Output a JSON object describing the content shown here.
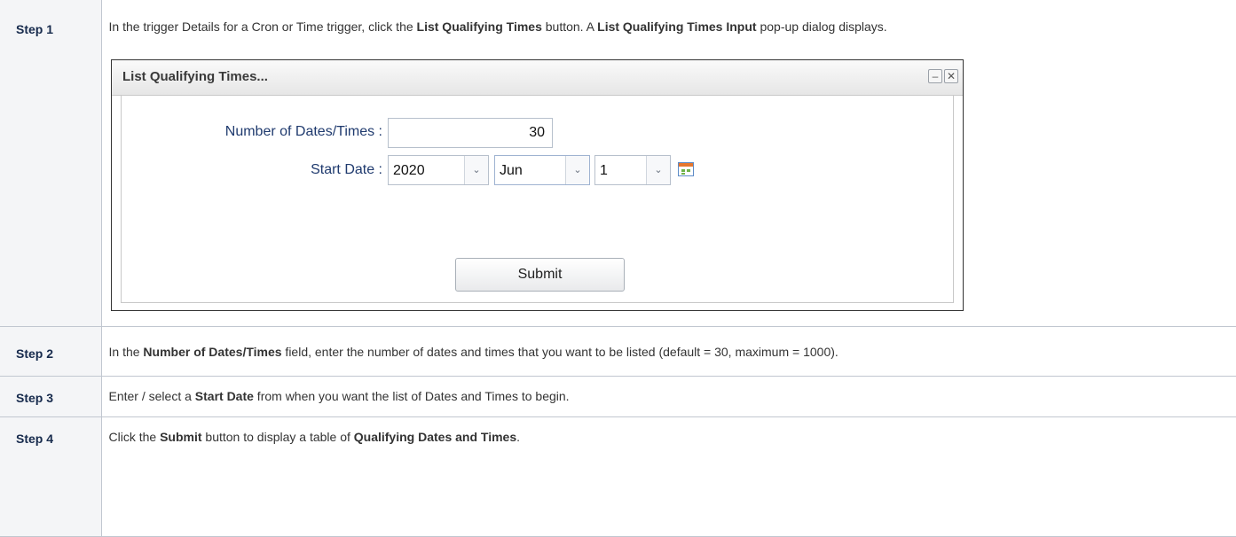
{
  "steps": [
    {
      "label": "Step 1",
      "parts": [
        {
          "t": "In the trigger Details for a Cron or Time trigger, click the "
        },
        {
          "t": "List Qualifying Times",
          "b": true
        },
        {
          "t": " button. A "
        },
        {
          "t": "List Qualifying Times Input",
          "b": true
        },
        {
          "t": " pop-up dialog displays."
        }
      ]
    },
    {
      "label": "Step 2",
      "parts": [
        {
          "t": "In the "
        },
        {
          "t": "Number of Dates/Times",
          "b": true
        },
        {
          "t": " field, enter the number of dates and times that you want to be listed (default = 30, maximum = 1000)."
        }
      ]
    },
    {
      "label": "Step 3",
      "parts": [
        {
          "t": "Enter / select a "
        },
        {
          "t": "Start Date",
          "b": true
        },
        {
          "t": " from when you want the list of Dates and Times to begin."
        }
      ]
    },
    {
      "label": "Step 4",
      "parts": [
        {
          "t": "Click the "
        },
        {
          "t": "Submit",
          "b": true
        },
        {
          "t": " button to display a table of "
        },
        {
          "t": "Qualifying Dates and Times",
          "b": true
        },
        {
          "t": "."
        }
      ]
    }
  ],
  "dialog": {
    "title": "List Qualifying Times...",
    "minimize_glyph": "–",
    "close_glyph": "✕",
    "number_label": "Number of Dates/Times :",
    "number_value": "30",
    "start_date_label": "Start Date :",
    "year": "2020",
    "month": "Jun",
    "day": "1",
    "dropdown_glyph": "⌄",
    "submit_label": "Submit"
  }
}
